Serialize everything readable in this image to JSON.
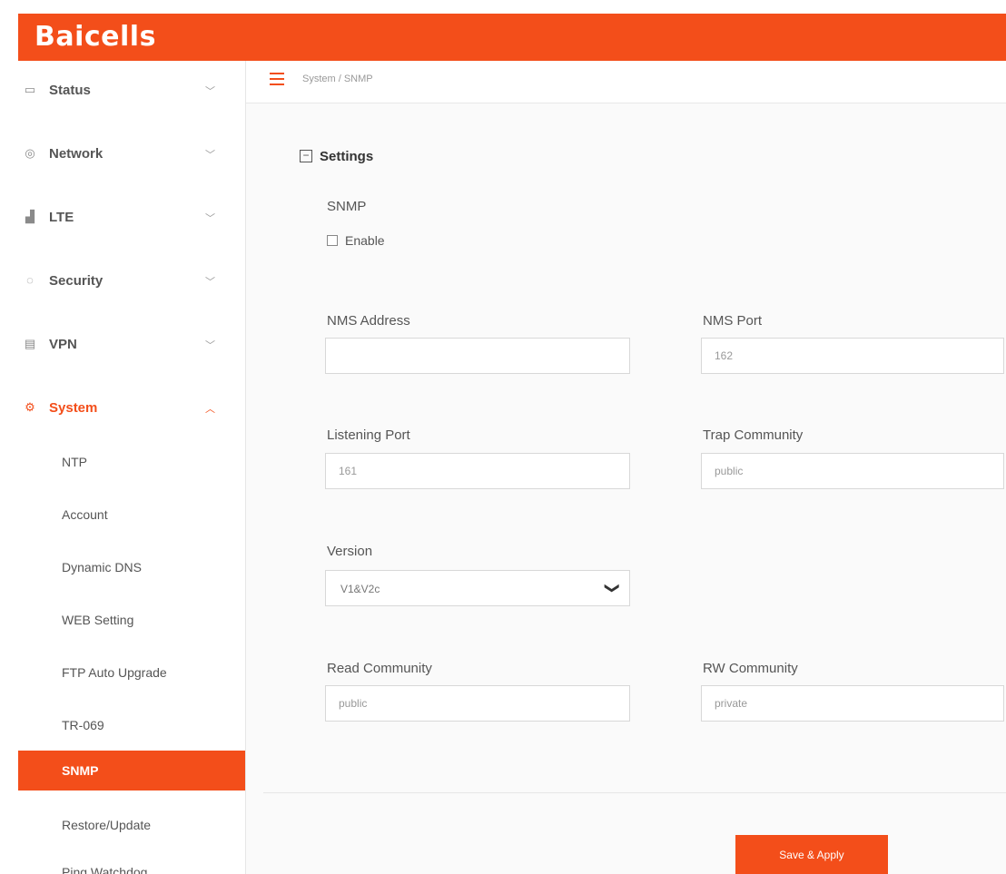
{
  "app": {
    "logo_text": "Baicells",
    "brand_color": "#f34e1a"
  },
  "sidebar": {
    "menu": [
      {
        "label": "Status",
        "icon": "monitor-icon"
      },
      {
        "label": "Network",
        "icon": "globe-icon"
      },
      {
        "label": "LTE",
        "icon": "signal-bars-icon"
      },
      {
        "label": "Security",
        "icon": "shield-icon"
      },
      {
        "label": "VPN",
        "icon": "vpn-icon"
      },
      {
        "label": "System",
        "icon": "gear-icon",
        "expanded": true
      }
    ],
    "submenu": [
      {
        "label": "NTP"
      },
      {
        "label": "Account"
      },
      {
        "label": "Dynamic DNS"
      },
      {
        "label": "WEB Setting"
      },
      {
        "label": "FTP Auto Upgrade"
      },
      {
        "label": "TR-069"
      },
      {
        "label": "SNMP",
        "selected": true
      },
      {
        "label": "Restore/Update"
      },
      {
        "label": "Ping Watchdog"
      }
    ]
  },
  "breadcrumb": {
    "text": "System / SNMP"
  },
  "settings": {
    "title": "Settings",
    "snmp_label": "SNMP",
    "enable_label": "Enable",
    "enable_checked": false,
    "nms_address": {
      "label": "NMS Address",
      "value": ""
    },
    "nms_port": {
      "label": "NMS Port",
      "value": "162"
    },
    "listening_port": {
      "label": "Listening Port",
      "value": "161"
    },
    "trap_community": {
      "label": "Trap Community",
      "value": "public"
    },
    "version": {
      "label": "Version",
      "selected": "V1&V2c"
    },
    "read_community": {
      "label": "Read Community",
      "value": "public"
    },
    "rw_community": {
      "label": "RW Community",
      "value": "private"
    }
  },
  "actions": {
    "save_apply": "Save & Apply"
  }
}
